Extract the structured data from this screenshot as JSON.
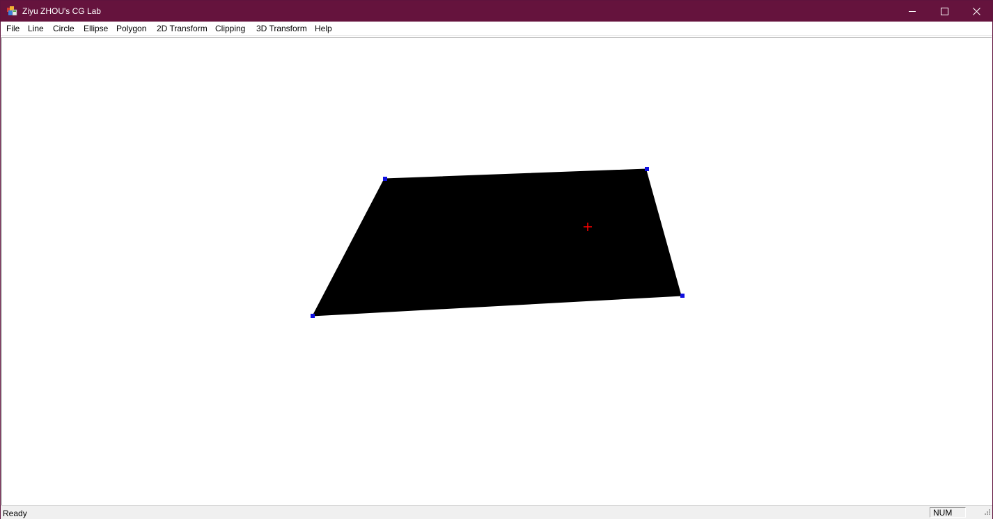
{
  "window": {
    "title": "Ziyu ZHOU's CG Lab",
    "titlebar_color": "#65133d",
    "app_icon": "mfc-app-icon",
    "controls": {
      "minimize_icon": "minimize-icon",
      "maximize_icon": "maximize-icon",
      "close_icon": "close-icon"
    }
  },
  "menu": {
    "items": [
      {
        "label": "File"
      },
      {
        "label": "Line"
      },
      {
        "label": "Circle"
      },
      {
        "label": "Ellipse"
      },
      {
        "label": "Polygon"
      },
      {
        "label": "2D Transform"
      },
      {
        "label": "Clipping"
      },
      {
        "label": "3D Transform"
      },
      {
        "label": "Help"
      }
    ]
  },
  "canvas": {
    "polygon_fill": "#000000",
    "vertex_handle_color": "#1010e0",
    "center_marker_color": "#ff0000",
    "center_marker_icon": "crosshair-icon"
  },
  "status": {
    "text": "Ready",
    "indicator": "NUM"
  }
}
